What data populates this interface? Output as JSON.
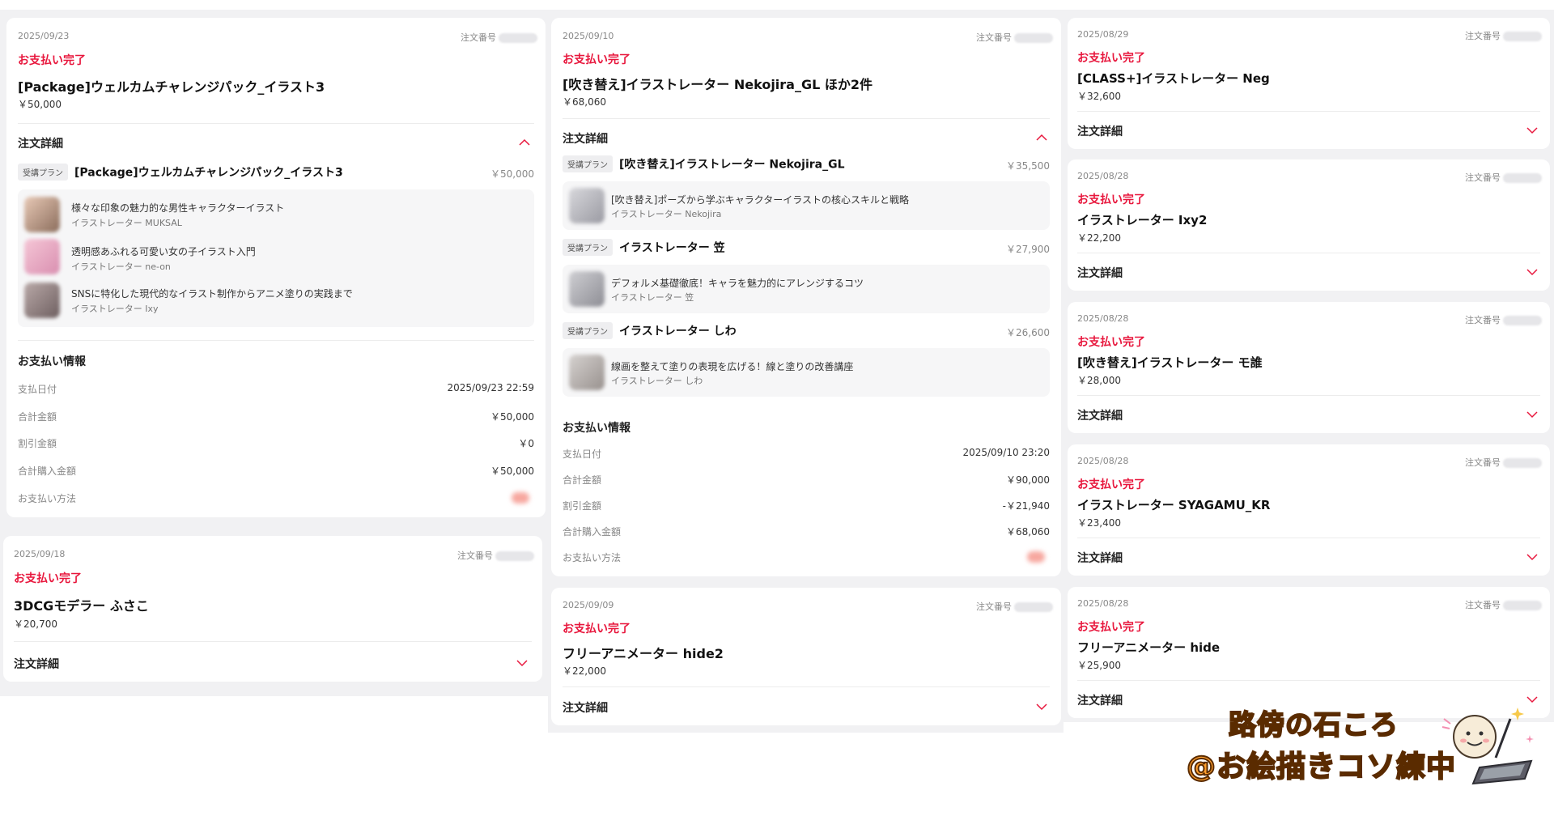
{
  "common": {
    "order_label": "注文番号",
    "status_paid": "お支払い完了",
    "order_details": "注文詳細",
    "plan_badge": "受講プラン",
    "payment_info": "お支払い情報",
    "pay_date_label": "支払日付",
    "total_label": "合計金額",
    "discount_label": "割引金額",
    "purchase_total_label": "合計購入金額",
    "pay_method_label": "お支払い方法"
  },
  "orders": [
    {
      "date": "2025/09/23",
      "title": "[Package]ウェルカムチャレンジパック_イラスト3",
      "price": "￥50,000",
      "plans": [
        {
          "name": "[Package]ウェルカムチャレンジパック_イラスト3",
          "price": "￥50,000",
          "courses": [
            {
              "title": "様々な印象の魅力的な男性キャラクターイラスト",
              "author": "イラストレーター MUKSAL"
            },
            {
              "title": "透明感あふれる可愛い女の子イラスト入門",
              "author": "イラストレーター ne-on"
            },
            {
              "title": "SNSに特化した現代的なイラスト制作からアニメ塗りの実践まで",
              "author": "イラストレーター Ixy"
            }
          ]
        }
      ],
      "payment": {
        "date": "2025/09/23 22:59",
        "total": "￥50,000",
        "discount": "￥0",
        "purchase_total": "￥50,000"
      }
    },
    {
      "date": "2025/09/18",
      "title": "3DCGモデラー ふさこ",
      "price": "￥20,700"
    },
    {
      "date": "2025/09/10",
      "title": "[吹き替え]イラストレーター Nekojira_GL ほか2件",
      "price": "￥68,060",
      "plans": [
        {
          "name": "[吹き替え]イラストレーター Nekojira_GL",
          "price": "￥35,500",
          "courses": [
            {
              "title": "[吹き替え]ポーズから学ぶキャラクターイラストの核心スキルと戦略",
              "author": "イラストレーター Nekojira"
            }
          ]
        },
        {
          "name": "イラストレーター 笠",
          "price": "￥27,900",
          "courses": [
            {
              "title": "デフォルメ基礎徹底！キャラを魅力的にアレンジするコツ",
              "author": "イラストレーター 笠"
            }
          ]
        },
        {
          "name": "イラストレーター しわ",
          "price": "￥26,600",
          "courses": [
            {
              "title": "線画を整えて塗りの表現を広げる！線と塗りの改善講座",
              "author": "イラストレーター しわ"
            }
          ]
        }
      ],
      "payment": {
        "date": "2025/09/10 23:20",
        "total": "￥90,000",
        "discount": "-￥21,940",
        "purchase_total": "￥68,060"
      }
    },
    {
      "date": "2025/09/09",
      "title": "フリーアニメーター hide2",
      "price": "￥22,000"
    },
    {
      "date": "2025/08/29",
      "title": "[CLASS+]イラストレーター Neg",
      "price": "￥32,600"
    },
    {
      "date": "2025/08/28",
      "title": "イラストレーター Ixy2",
      "price": "￥22,200"
    },
    {
      "date": "2025/08/28",
      "title": "[吹き替え]イラストレーター モ誰",
      "price": "￥28,000"
    },
    {
      "date": "2025/08/28",
      "title": "イラストレーター SYAGAMU_KR",
      "price": "￥23,400"
    },
    {
      "date": "2025/08/28",
      "title": "フリーアニメーター hide",
      "price": "￥25,900"
    }
  ],
  "branding": {
    "line1": "路傍の石ころ",
    "line2": "@お絵描きコソ練中"
  },
  "colors": {
    "status_red": "#e8173d",
    "panel_bg": "#f1f1f3",
    "brand_orange": "#ff9f2e"
  }
}
